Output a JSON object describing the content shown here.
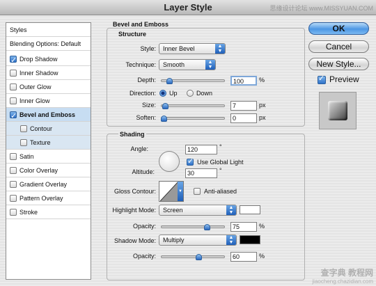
{
  "window": {
    "title": "Layer Style",
    "watermark": "思缘设计论坛 www.MISSYUAN.COM"
  },
  "styles_list": {
    "header": "Styles",
    "blending": "Blending Options: Default",
    "items": [
      {
        "label": "Drop Shadow",
        "checked": true
      },
      {
        "label": "Inner Shadow",
        "checked": false
      },
      {
        "label": "Outer Glow",
        "checked": false
      },
      {
        "label": "Inner Glow",
        "checked": false
      },
      {
        "label": "Bevel and Emboss",
        "checked": true,
        "selected": true
      },
      {
        "label": "Contour",
        "checked": false,
        "sub": true
      },
      {
        "label": "Texture",
        "checked": false,
        "sub": true
      },
      {
        "label": "Satin",
        "checked": false
      },
      {
        "label": "Color Overlay",
        "checked": false
      },
      {
        "label": "Gradient Overlay",
        "checked": false
      },
      {
        "label": "Pattern Overlay",
        "checked": false
      },
      {
        "label": "Stroke",
        "checked": false
      }
    ]
  },
  "bevel": {
    "title": "Bevel and Emboss",
    "structure": {
      "title": "Structure",
      "style_label": "Style:",
      "style_value": "Inner Bevel",
      "technique_label": "Technique:",
      "technique_value": "Smooth",
      "depth_label": "Depth:",
      "depth_value": "100",
      "depth_unit": "%",
      "depth_level": 0.1,
      "direction_label": "Direction:",
      "direction_up": "Up",
      "direction_down": "Down",
      "size_label": "Size:",
      "size_value": "7",
      "size_unit": "px",
      "size_level": 0.03,
      "soften_label": "Soften:",
      "soften_value": "0",
      "soften_unit": "px",
      "soften_level": 0.0
    },
    "shading": {
      "title": "Shading",
      "angle_label": "Angle:",
      "angle_value": "120",
      "angle_unit": "°",
      "global_light_label": "Use Global Light",
      "global_light": true,
      "altitude_label": "Altitude:",
      "altitude_value": "30",
      "altitude_unit": "°",
      "gloss_label": "Gloss Contour:",
      "anti_aliased_label": "Anti-aliased",
      "anti_aliased": false,
      "highlight_mode_label": "Highlight Mode:",
      "highlight_mode_value": "Screen",
      "highlight_color": "#ffffff",
      "highlight_opacity_label": "Opacity:",
      "highlight_opacity_value": "75",
      "highlight_opacity_unit": "%",
      "highlight_opacity_level": 0.75,
      "shadow_mode_label": "Shadow Mode:",
      "shadow_mode_value": "Multiply",
      "shadow_color": "#000000",
      "shadow_opacity_label": "Opacity:",
      "shadow_opacity_value": "60",
      "shadow_opacity_unit": "%",
      "shadow_opacity_level": 0.6
    }
  },
  "buttons": {
    "ok": "OK",
    "cancel": "Cancel",
    "new_style": "New Style...",
    "preview_label": "Preview",
    "preview_checked": true
  },
  "footer_watermark": {
    "main": "查字典 教程网",
    "url": "jiaocheng.chazidian.com"
  }
}
